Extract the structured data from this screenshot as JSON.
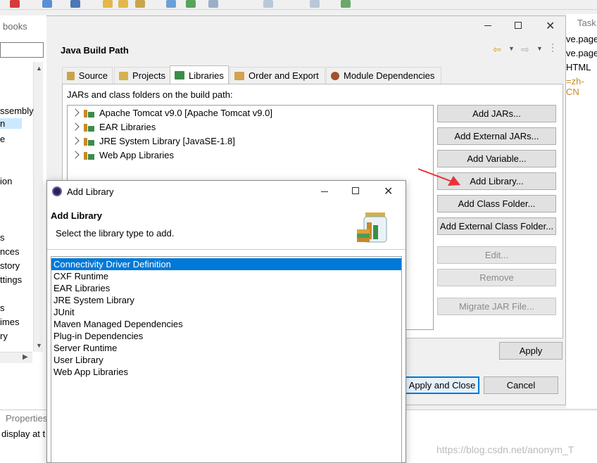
{
  "toolbar": {
    "icons": [
      "run-icon",
      "debug-icon",
      "external-tools-icon",
      "new-icon",
      "open-folder-icon",
      "search-icon",
      "globe-icon",
      "next-annotation-icon",
      "prev-annotation-icon",
      "back-icon",
      "forward-icon",
      "pin-icon"
    ]
  },
  "bg_window": {
    "title": "books"
  },
  "left_panel": {
    "items": [
      "ssembly",
      "n",
      "e",
      "ion",
      "s",
      "nces",
      "story",
      "ttings",
      "s",
      "imes",
      "ry"
    ]
  },
  "right_editor": {
    "tab": "Task",
    "lines": [
      "ve.page",
      "ve.page",
      "HTML",
      "=zh-CN"
    ]
  },
  "properties": {
    "tab": "Properties",
    "text": "display at t"
  },
  "build_path": {
    "title": "Java Build Path",
    "tabs": [
      "Source",
      "Projects",
      "Libraries",
      "Order and Export",
      "Module Dependencies"
    ],
    "section_label": "JARs and class folders on the build path:",
    "entries": [
      "Apache Tomcat v9.0 [Apache Tomcat v9.0]",
      "EAR Libraries",
      "JRE System Library [JavaSE-1.8]",
      "Web App Libraries"
    ],
    "buttons": {
      "add_jars": "Add JARs...",
      "add_external_jars": "Add External JARs...",
      "add_variable": "Add Variable...",
      "add_library": "Add Library...",
      "add_class_folder": "Add Class Folder...",
      "add_external_class_folder": "Add External Class Folder...",
      "edit": "Edit...",
      "remove": "Remove",
      "migrate": "Migrate JAR File..."
    },
    "apply": "Apply",
    "apply_close": "Apply and Close",
    "cancel": "Cancel"
  },
  "add_library": {
    "window_title": "Add Library",
    "heading": "Add Library",
    "description": "Select the library type to add.",
    "items": [
      "Connectivity Driver Definition",
      "CXF Runtime",
      "EAR Libraries",
      "JRE System Library",
      "JUnit",
      "Maven Managed Dependencies",
      "Plug-in Dependencies",
      "Server Runtime",
      "User Library",
      "Web App Libraries"
    ],
    "selected_index": 0
  },
  "watermark": "https://blog.csdn.net/anonym_T",
  "colors": {
    "accent": "#0078d7",
    "arrow": "#e8333a"
  }
}
